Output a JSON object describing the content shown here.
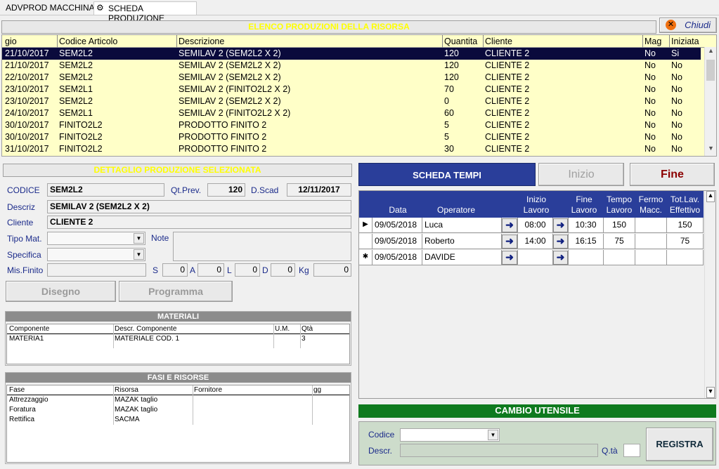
{
  "tabs": [
    {
      "label": "ADVPROD MACCHINA"
    },
    {
      "label": "SCHEDA PRODUZIONE"
    }
  ],
  "chiudi": "Chiudi",
  "list": {
    "title": "ELENCO PRODUZIONI DELLA RISORSA",
    "columns": [
      "gio",
      "Codice Articolo",
      "Descrizione",
      "Quantita",
      "Cliente",
      "Mag",
      "Iniziata"
    ],
    "rows": [
      [
        "21/10/2017",
        "SEM2L2",
        "SEMILAV 2 (SEM2L2 X 2)",
        "120",
        "CLIENTE 2",
        "No",
        "Si"
      ],
      [
        "21/10/2017",
        "SEM2L2",
        "SEMILAV 2 (SEM2L2 X 2)",
        "120",
        "CLIENTE 2",
        "No",
        "No"
      ],
      [
        "22/10/2017",
        "SEM2L2",
        "SEMILAV 2 (SEM2L2 X 2)",
        "120",
        "CLIENTE 2",
        "No",
        "No"
      ],
      [
        "23/10/2017",
        "SEM2L1",
        "SEMILAV 2 (FINITO2L2 X 2)",
        "70",
        "CLIENTE 2",
        "No",
        "No"
      ],
      [
        "23/10/2017",
        "SEM2L2",
        "SEMILAV 2 (SEM2L2 X 2)",
        "0",
        "CLIENTE 2",
        "No",
        "No"
      ],
      [
        "24/10/2017",
        "SEM2L1",
        "SEMILAV 2 (FINITO2L2 X 2)",
        "60",
        "CLIENTE 2",
        "No",
        "No"
      ],
      [
        "30/10/2017",
        "FINITO2L2",
        "PRODOTTO FINITO 2",
        "5",
        "CLIENTE 2",
        "No",
        "No"
      ],
      [
        "30/10/2017",
        "FINITO2L2",
        "PRODOTTO FINITO 2",
        "5",
        "CLIENTE 2",
        "No",
        "No"
      ],
      [
        "31/10/2017",
        "FINITO2L2",
        "PRODOTTO FINITO 2",
        "30",
        "CLIENTE 2",
        "No",
        "No"
      ]
    ]
  },
  "detail": {
    "title": "DETTAGLIO PRODUZIONE SELEZIONATA",
    "codice_label": "CODICE",
    "codice": "SEM2L2",
    "qtprev_label": "Qt.Prev.",
    "qtprev": "120",
    "dscad_label": "D.Scad",
    "dscad": "12/11/2017",
    "descriz_label": "Descriz",
    "descriz": "SEMILAV 2 (SEM2L2 X 2)",
    "cliente_label": "Cliente",
    "cliente": "CLIENTE 2",
    "tipomat_label": "Tipo Mat.",
    "note_label": "Note",
    "specifica_label": "Specifica",
    "misfinito_label": "Mis.Finito",
    "s_label": "S",
    "s": "0",
    "a_label": "A",
    "a": "0",
    "l_label": "L",
    "l": "0",
    "d_label": "D",
    "d": "0",
    "kg_label": "Kg",
    "kg": "0",
    "disegno": "Disegno",
    "programma": "Programma"
  },
  "materiali": {
    "title": "MATERIALI",
    "columns": [
      "Componente",
      "Descr. Componente",
      "U.M.",
      "Qtà"
    ],
    "rows": [
      [
        "MATERIA1",
        "MATERIALE COD. 1",
        "",
        "3"
      ]
    ]
  },
  "fasi": {
    "title": "FASI E RISORSE",
    "columns": [
      "Fase",
      "Risorsa",
      "Fornitore",
      "gg"
    ],
    "rows": [
      [
        "Attrezzaggio",
        "MAZAK taglio",
        "",
        ""
      ],
      [
        "Foratura",
        "MAZAK taglio",
        "",
        ""
      ],
      [
        "Rettifica",
        "SACMA",
        "",
        ""
      ]
    ]
  },
  "tempi": {
    "scheda": "SCHEDA TEMPI",
    "inizio": "Inizio",
    "fine": "Fine",
    "columns": [
      "Data",
      "Operatore",
      "Inizio Lavoro",
      "Fine Lavoro",
      "Tempo Lavoro",
      "Fermo Macc.",
      "Tot.Lav. Effettivo"
    ],
    "rows": [
      {
        "marker": "▶",
        "data": "09/05/2018",
        "operatore": "Luca",
        "inizio": "08:00",
        "fine": "10:30",
        "tempo": "150",
        "fermo": "",
        "tot": "150"
      },
      {
        "marker": "",
        "data": "09/05/2018",
        "operatore": "Roberto",
        "inizio": "14:00",
        "fine": "16:15",
        "tempo": "75",
        "fermo": "",
        "tot": "75"
      },
      {
        "marker": "✱",
        "data": "09/05/2018",
        "operatore": "DAVIDE",
        "inizio": "",
        "fine": "",
        "tempo": "",
        "fermo": "",
        "tot": ""
      }
    ]
  },
  "cambio": {
    "title": "CAMBIO UTENSILE",
    "codice_label": "Codice",
    "descr_label": "Descr.",
    "qta_label": "Q.tà",
    "registra": "REGISTRA"
  }
}
